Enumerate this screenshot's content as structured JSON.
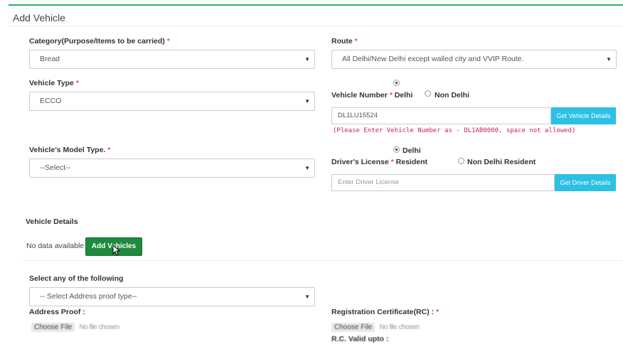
{
  "panel": {
    "title": "Add Vehicle"
  },
  "category": {
    "label": "Category(Purpose/Items to be carried)",
    "required": "*",
    "value": "Bread"
  },
  "route": {
    "label": "Route",
    "required": "*",
    "value": "All Delhi/New Delhi except walled city and VVIP Route."
  },
  "vehicle_type": {
    "label": "Vehicle Type",
    "required": "*",
    "value": "ECCO"
  },
  "vehicle_number": {
    "label": "Vehicle Number",
    "required": "*",
    "option_delhi": "Delhi",
    "option_non_delhi": "Non Delhi",
    "selected": "Delhi",
    "value": "DL1LU15524",
    "button": "Get Vehicle Details",
    "hint": "(Please Enter Vehicle Number as - DL1AB0000, space not allowed)"
  },
  "model_type": {
    "label": "Vehicle's Model Type.",
    "required": "*",
    "value": "--Select--"
  },
  "drivers_license": {
    "label": "Driver's License",
    "required": "*",
    "option_resident": "Resident",
    "option_delhi": "Delhi",
    "option_non_delhi": "Non Delhi Resident",
    "selected": "Delhi",
    "placeholder": "Enter Driver License",
    "button": "Get Driver Details"
  },
  "vehicle_details": {
    "label": "Vehicle Details",
    "empty_text": "No data available",
    "add_button": "Add Vehicles"
  },
  "address_proof_type": {
    "label": "Select any of the following",
    "value": "-- Select Address proof type--"
  },
  "address_proof": {
    "label": "Address Proof :",
    "file_button": "Choose File",
    "file_text": "No file chosen"
  },
  "rc": {
    "label": "Registration Certificate(RC) :",
    "required": "*",
    "file_button": "Choose File",
    "file_text": "No file chosen",
    "valid_label": "R.C. Valid upto :"
  },
  "colors": {
    "accent_green": "#27ae60",
    "success_button": "#1e8a3e",
    "info_button": "#2bc0e4",
    "required_star": "#d9534f",
    "hint_text": "#c7254e"
  }
}
